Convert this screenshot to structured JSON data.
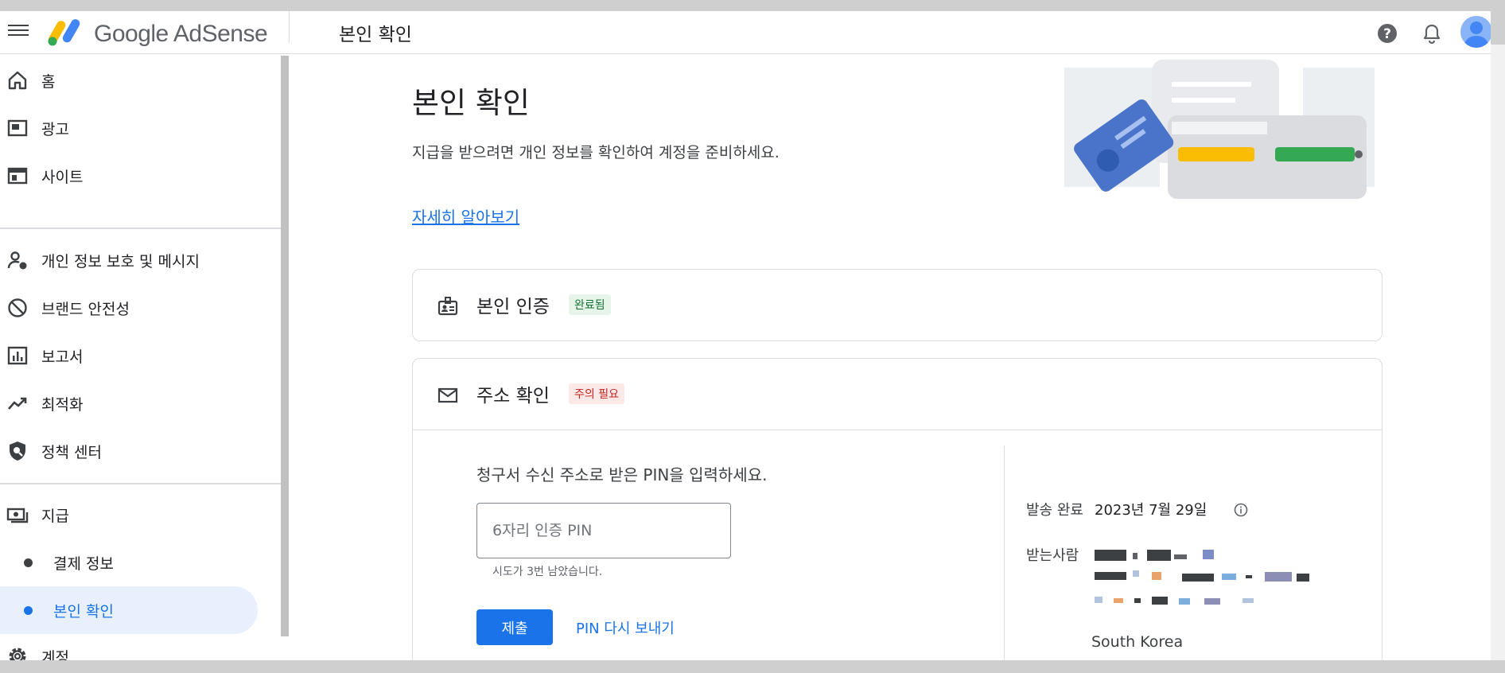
{
  "header": {
    "brand": "Google AdSense",
    "page_title": "본인 확인",
    "icons": [
      "menu-icon",
      "help-icon",
      "notifications-bell-icon",
      "account-avatar"
    ]
  },
  "sidebar": {
    "items": [
      {
        "label": "홈",
        "icon": "home-icon"
      },
      {
        "label": "광고",
        "icon": "ads-icon"
      },
      {
        "label": "사이트",
        "icon": "sites-icon"
      },
      {
        "label": "개인 정보 보호 및 메시지",
        "icon": "privacy-person-icon"
      },
      {
        "label": "브랜드 안전성",
        "icon": "block-icon"
      },
      {
        "label": "보고서",
        "icon": "bar-chart-icon"
      },
      {
        "label": "최적화",
        "icon": "trending-up-icon"
      },
      {
        "label": "정책 센터",
        "icon": "policy-shield-icon"
      },
      {
        "label": "지급",
        "icon": "payments-icon"
      },
      {
        "label": "계정",
        "icon": "settings-gear-icon"
      }
    ],
    "sub_items": [
      {
        "label": "결제 정보",
        "active": false
      },
      {
        "label": "본인 확인",
        "active": true
      }
    ]
  },
  "main": {
    "title": "본인 확인",
    "description": "지급을 받으려면 개인 정보를 확인하여 계정을 준비하세요.",
    "learn_more": "자세히 알아보기",
    "identity_card": {
      "title": "본인 인증",
      "status": "완료됨"
    },
    "address_card": {
      "title": "주소 확인",
      "status": "주의 필요",
      "prompt": "청구서 수신 주소로 받은 PIN을 입력하세요.",
      "pin_placeholder": "6자리 인증 PIN",
      "attempts_left": "시도가 3번 남았습니다.",
      "submit_label": "제출",
      "resend_label": "PIN 다시 보내기",
      "sent_label": "발송 완료",
      "sent_date": "2023년 7월 29일",
      "recipient_label": "받는사람",
      "country": "South Korea"
    }
  },
  "colors": {
    "accent": "#1a73e8",
    "success_bg": "#e6f4ea",
    "success_text": "#137333",
    "warn_bg": "#fce8e6",
    "warn_text": "#c5221f"
  }
}
